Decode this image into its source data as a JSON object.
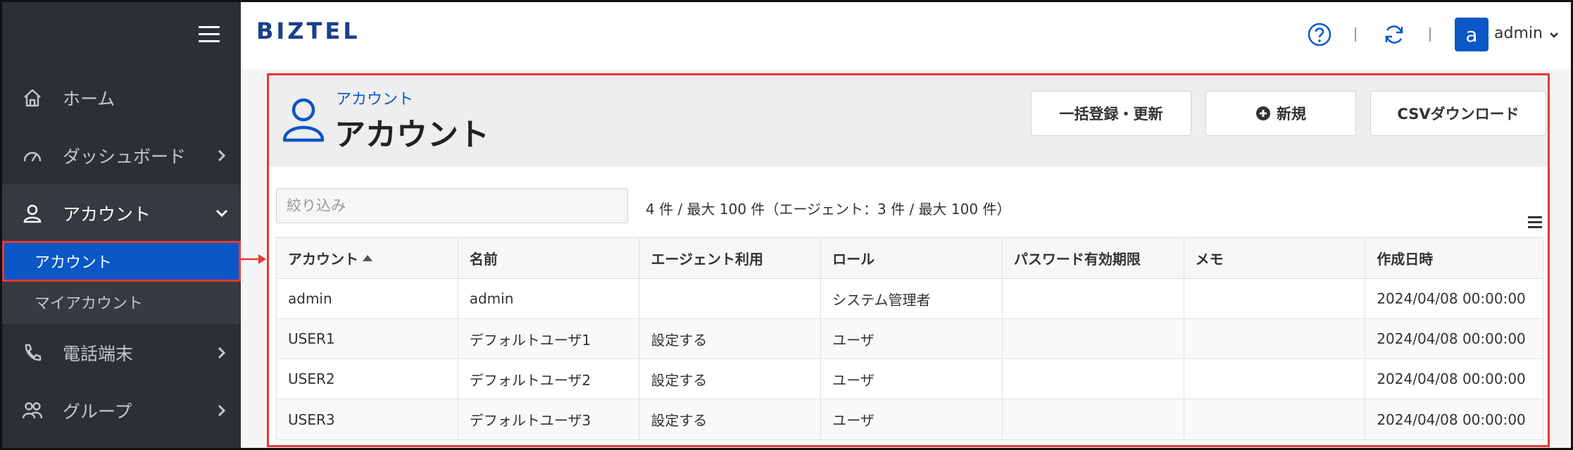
{
  "sidebar": {
    "items": [
      {
        "label": "ホーム"
      },
      {
        "label": "ダッシュボード"
      },
      {
        "label": "アカウント"
      },
      {
        "label": "電話端末"
      },
      {
        "label": "グループ"
      }
    ],
    "sub_items": [
      {
        "label": "アカウント"
      },
      {
        "label": "マイアカウント"
      }
    ]
  },
  "topbar": {
    "logo": "BIZTEL",
    "avatar_letter": "a",
    "user_name": "admin"
  },
  "page": {
    "breadcrumb": "アカウント",
    "title": "アカウント",
    "buttons": {
      "bulk": "一括登録・更新",
      "new": "新規",
      "csv": "CSVダウンロード"
    },
    "filter_placeholder": "絞り込み",
    "count_text": "4 件 / 最大 100 件（エージェント：3 件 / 最大 100 件）"
  },
  "table": {
    "columns": [
      "アカウント",
      "名前",
      "エージェント利用",
      "ロール",
      "パスワード有効期限",
      "メモ",
      "作成日時"
    ],
    "rows": [
      [
        "admin",
        "admin",
        "",
        "システム管理者",
        "",
        "",
        "2024/04/08 00:00:00"
      ],
      [
        "USER1",
        "デフォルトユーザ1",
        "設定する",
        "ユーザ",
        "",
        "",
        "2024/04/08 00:00:00"
      ],
      [
        "USER2",
        "デフォルトユーザ2",
        "設定する",
        "ユーザ",
        "",
        "",
        "2024/04/08 00:00:00"
      ],
      [
        "USER3",
        "デフォルトユーザ3",
        "設定する",
        "ユーザ",
        "",
        "",
        "2024/04/08 00:00:00"
      ]
    ]
  },
  "colors": {
    "sidebar_bg": "#2b3035",
    "accent": "#0a57c5",
    "highlight": "#e53935"
  }
}
